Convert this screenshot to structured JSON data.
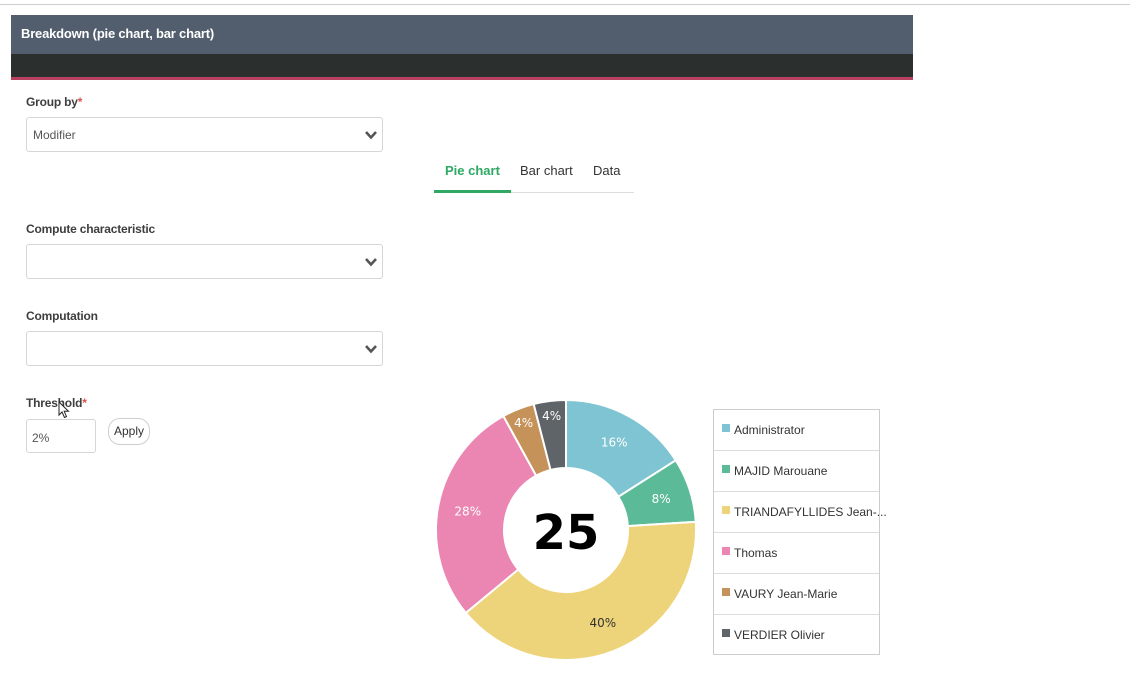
{
  "panel": {
    "title": "Breakdown (pie chart, bar chart)"
  },
  "form": {
    "group_by": {
      "label": "Group by",
      "required_mark": "*",
      "value": "Modifier"
    },
    "compute_characteristic": {
      "label": "Compute characteristic",
      "value": ""
    },
    "computation": {
      "label": "Computation",
      "value": ""
    },
    "threshold": {
      "label": "Threshold",
      "required_mark": "*",
      "value": "2%"
    },
    "apply_label": "Apply"
  },
  "tabs": [
    {
      "label": "Pie chart",
      "active": true
    },
    {
      "label": "Bar chart",
      "active": false
    },
    {
      "label": "Data",
      "active": false
    }
  ],
  "chart_data": {
    "type": "pie",
    "donut": true,
    "center_text": "25",
    "categories": [
      "Administrator",
      "MAJID Marouane",
      "TRIANDAFYLLIDES Jean-...",
      "Thomas",
      "VAURY Jean-Marie",
      "VERDIER Olivier"
    ],
    "values": [
      16,
      8,
      40,
      28,
      4,
      4
    ],
    "labels": [
      "16%",
      "8%",
      "40%",
      "28%",
      "4%",
      "4%"
    ],
    "colors": [
      "#7fc4d2",
      "#5bbb98",
      "#edd47a",
      "#ea86b1",
      "#c5925a",
      "#5f6469"
    ],
    "legend_position": "right"
  }
}
